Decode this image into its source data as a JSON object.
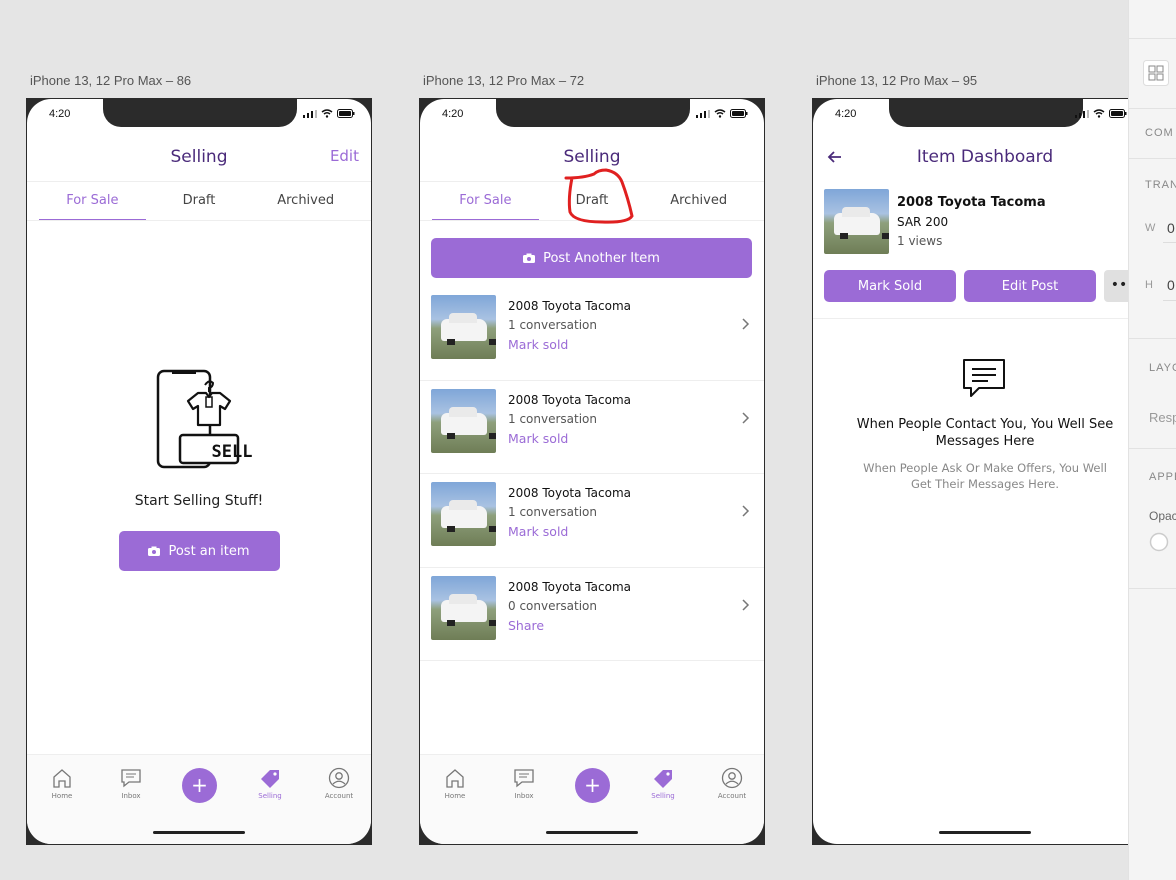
{
  "artboards": [
    {
      "label": "iPhone 13, 12 Pro Max – 86"
    },
    {
      "label": "iPhone 13, 12 Pro Max – 72"
    },
    {
      "label": "iPhone 13, 12 Pro Max – 95"
    }
  ],
  "status": {
    "time": "4:20"
  },
  "colors": {
    "accent": "#9b6bd6",
    "title": "#4a2a7a",
    "annotation": "#e02020"
  },
  "selling": {
    "title": "Selling",
    "edit_label": "Edit",
    "tabs": [
      "For Sale",
      "Draft",
      "Archived"
    ],
    "active_tab": "For Sale"
  },
  "empty_state": {
    "icon": "sell-phone-shirt-icon",
    "sell_badge": "SELL",
    "text": "Start Selling Stuff!",
    "button_label": "Post an item"
  },
  "listing": {
    "post_another_label": "Post Another Item",
    "items": [
      {
        "title": "2008 Toyota Tacoma",
        "subtitle": "1 conversation",
        "action": "Mark sold"
      },
      {
        "title": "2008 Toyota Tacoma",
        "subtitle": "1 conversation",
        "action": "Mark sold"
      },
      {
        "title": "2008 Toyota Tacoma",
        "subtitle": "1 conversation",
        "action": "Mark sold"
      },
      {
        "title": "2008 Toyota Tacoma",
        "subtitle": "0 conversation",
        "action": "Share"
      }
    ]
  },
  "nav": {
    "items": [
      {
        "label": "Home",
        "icon": "home-icon"
      },
      {
        "label": "Inbox",
        "icon": "chat-icon"
      },
      {
        "label": "+",
        "icon": "plus-icon"
      },
      {
        "label": "Selling",
        "icon": "tag-icon"
      },
      {
        "label": "Account",
        "icon": "user-icon"
      }
    ],
    "active": "Selling"
  },
  "dashboard": {
    "title": "Item Dashboard",
    "item_title": "2008 Toyota Tacoma",
    "price": "SAR 200",
    "views": "1 views",
    "mark_sold_label": "Mark Sold",
    "edit_post_label": "Edit Post",
    "more_label": "••",
    "empty_title": "When People Contact You, You Well See Messages Here",
    "empty_subtitle": "When People Ask Or Make Offers, You Well Get Their Messages Here."
  },
  "side_panel": {
    "labels": [
      "COM",
      "TRAN",
      "LAYO",
      "APPE"
    ],
    "w_label": "W",
    "w_value": "0",
    "h_label": "H",
    "h_value": "0",
    "layout_text": "Resp",
    "opacity_label": "Opac"
  }
}
